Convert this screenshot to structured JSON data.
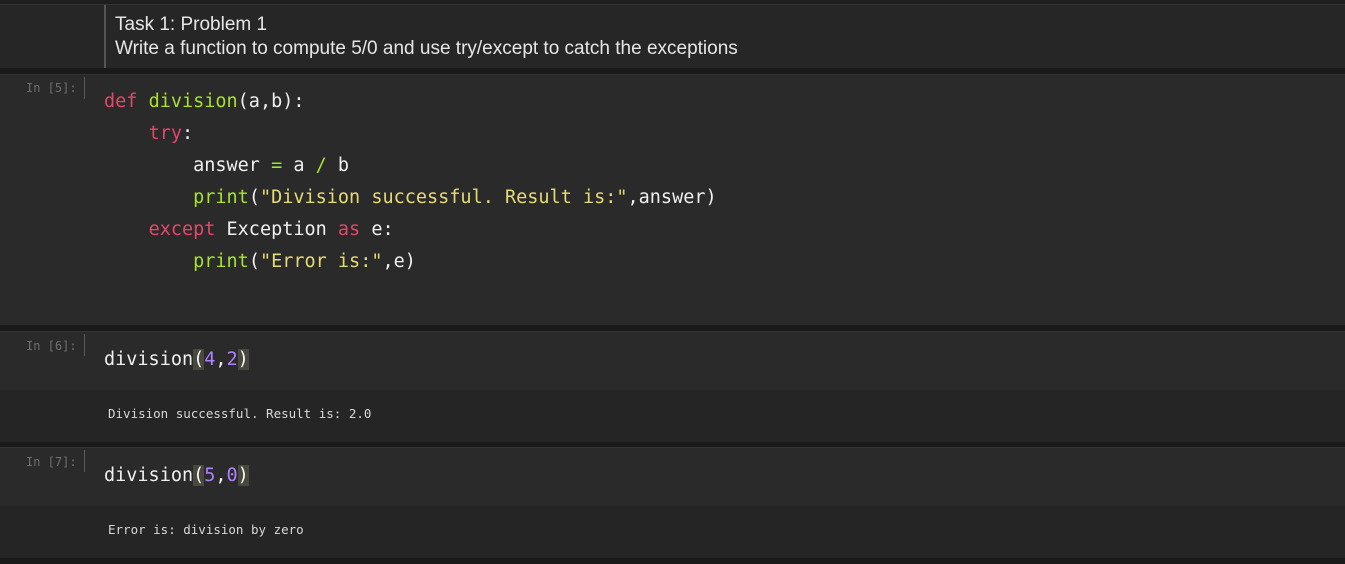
{
  "markdown": {
    "title": "Task 1: Problem 1",
    "description": "Write a function to compute 5/0 and use try/except to catch the exceptions"
  },
  "cells": [
    {
      "prompt": "In [5]:",
      "code": {
        "def_kw": "def",
        "fn_name": "division",
        "sig": "(a,b):",
        "try_kw": "try",
        "try_colon": ":",
        "answer_var": "answer",
        "assign_op": "=",
        "a_var": " a ",
        "div_op": "/",
        "b_var": " b",
        "print1": "print",
        "print1_open": "(",
        "print1_str": "\"Division successful. Result is:\"",
        "print1_rest": ",answer)",
        "except_kw": "except",
        "exception_cls": " Exception ",
        "as_kw": "as",
        "e_var": " e:",
        "print2": "print",
        "print2_open": "(",
        "print2_str": "\"Error is:\"",
        "print2_rest": ",e)"
      }
    },
    {
      "prompt": "In [6]:",
      "call_name": "division",
      "open_paren": "(",
      "arg1": "4",
      "comma": ",",
      "arg2": "2",
      "close_paren": ")",
      "output": "Division successful. Result is: 2.0"
    },
    {
      "prompt": "In [7]:",
      "call_name": "division",
      "open_paren": "(",
      "arg1": "5",
      "comma": ",",
      "arg2": "0",
      "close_paren": ")",
      "output": "Error is: division by zero"
    }
  ]
}
